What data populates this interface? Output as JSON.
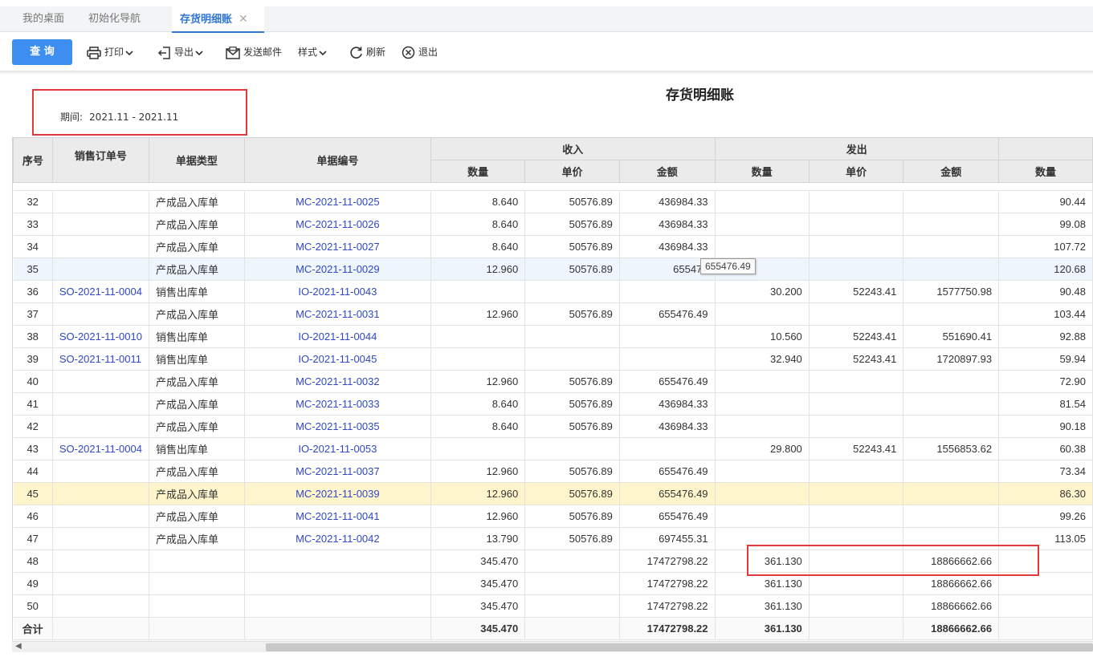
{
  "tabs": [
    {
      "label": "我的桌面"
    },
    {
      "label": "初始化导航"
    },
    {
      "label": "存货明细账"
    }
  ],
  "tab_close_glyph": "✕",
  "toolbar": {
    "query": "查 询",
    "print": "打印",
    "export": "导出",
    "email": "发送邮件",
    "style": "样式",
    "refresh": "刷新",
    "exit": "退出"
  },
  "report": {
    "title": "存货明细账",
    "period_label": "期间:",
    "period_value": "2021.11 - 2021.11"
  },
  "columns": {
    "seq": "序号",
    "order": "销售订单号",
    "type": "单据类型",
    "docno": "单据编号",
    "in_group": "收入",
    "out_group": "发出",
    "qty": "数量",
    "price": "单价",
    "amount": "金额"
  },
  "rows": [
    {
      "seq": "32",
      "order": "",
      "type": "产成品入库单",
      "docno": "MC-2021-11-0025",
      "in_qty": "8.640",
      "in_price": "50576.89",
      "in_amt": "436984.33",
      "out_qty": "",
      "out_price": "",
      "out_amt": "",
      "bal_qty": "90.44"
    },
    {
      "seq": "33",
      "order": "",
      "type": "产成品入库单",
      "docno": "MC-2021-11-0026",
      "in_qty": "8.640",
      "in_price": "50576.89",
      "in_amt": "436984.33",
      "out_qty": "",
      "out_price": "",
      "out_amt": "",
      "bal_qty": "99.08"
    },
    {
      "seq": "34",
      "order": "",
      "type": "产成品入库单",
      "docno": "MC-2021-11-0027",
      "in_qty": "8.640",
      "in_price": "50576.89",
      "in_amt": "436984.33",
      "out_qty": "",
      "out_price": "",
      "out_amt": "",
      "bal_qty": "107.72"
    },
    {
      "seq": "35",
      "order": "",
      "type": "产成品入库单",
      "docno": "MC-2021-11-0029",
      "in_qty": "12.960",
      "in_price": "50576.89",
      "in_amt": "655476",
      "out_qty": "",
      "out_price": "",
      "out_amt": "",
      "bal_qty": "120.68"
    },
    {
      "seq": "36",
      "order": "SO-2021-11-0004",
      "type": "销售出库单",
      "docno": "IO-2021-11-0043",
      "in_qty": "",
      "in_price": "",
      "in_amt": "",
      "out_qty": "30.200",
      "out_price": "52243.41",
      "out_amt": "1577750.98",
      "bal_qty": "90.48"
    },
    {
      "seq": "37",
      "order": "",
      "type": "产成品入库单",
      "docno": "MC-2021-11-0031",
      "in_qty": "12.960",
      "in_price": "50576.89",
      "in_amt": "655476.49",
      "out_qty": "",
      "out_price": "",
      "out_amt": "",
      "bal_qty": "103.44"
    },
    {
      "seq": "38",
      "order": "SO-2021-11-0010",
      "type": "销售出库单",
      "docno": "IO-2021-11-0044",
      "in_qty": "",
      "in_price": "",
      "in_amt": "",
      "out_qty": "10.560",
      "out_price": "52243.41",
      "out_amt": "551690.41",
      "bal_qty": "92.88"
    },
    {
      "seq": "39",
      "order": "SO-2021-11-0011",
      "type": "销售出库单",
      "docno": "IO-2021-11-0045",
      "in_qty": "",
      "in_price": "",
      "in_amt": "",
      "out_qty": "32.940",
      "out_price": "52243.41",
      "out_amt": "1720897.93",
      "bal_qty": "59.94"
    },
    {
      "seq": "40",
      "order": "",
      "type": "产成品入库单",
      "docno": "MC-2021-11-0032",
      "in_qty": "12.960",
      "in_price": "50576.89",
      "in_amt": "655476.49",
      "out_qty": "",
      "out_price": "",
      "out_amt": "",
      "bal_qty": "72.90"
    },
    {
      "seq": "41",
      "order": "",
      "type": "产成品入库单",
      "docno": "MC-2021-11-0033",
      "in_qty": "8.640",
      "in_price": "50576.89",
      "in_amt": "436984.33",
      "out_qty": "",
      "out_price": "",
      "out_amt": "",
      "bal_qty": "81.54"
    },
    {
      "seq": "42",
      "order": "",
      "type": "产成品入库单",
      "docno": "MC-2021-11-0035",
      "in_qty": "8.640",
      "in_price": "50576.89",
      "in_amt": "436984.33",
      "out_qty": "",
      "out_price": "",
      "out_amt": "",
      "bal_qty": "90.18"
    },
    {
      "seq": "43",
      "order": "SO-2021-11-0004",
      "type": "销售出库单",
      "docno": "IO-2021-11-0053",
      "in_qty": "",
      "in_price": "",
      "in_amt": "",
      "out_qty": "29.800",
      "out_price": "52243.41",
      "out_amt": "1556853.62",
      "bal_qty": "60.38"
    },
    {
      "seq": "44",
      "order": "",
      "type": "产成品入库单",
      "docno": "MC-2021-11-0037",
      "in_qty": "12.960",
      "in_price": "50576.89",
      "in_amt": "655476.49",
      "out_qty": "",
      "out_price": "",
      "out_amt": "",
      "bal_qty": "73.34"
    },
    {
      "seq": "45",
      "order": "",
      "type": "产成品入库单",
      "docno": "MC-2021-11-0039",
      "in_qty": "12.960",
      "in_price": "50576.89",
      "in_amt": "655476.49",
      "out_qty": "",
      "out_price": "",
      "out_amt": "",
      "bal_qty": "86.30"
    },
    {
      "seq": "46",
      "order": "",
      "type": "产成品入库单",
      "docno": "MC-2021-11-0041",
      "in_qty": "12.960",
      "in_price": "50576.89",
      "in_amt": "655476.49",
      "out_qty": "",
      "out_price": "",
      "out_amt": "",
      "bal_qty": "99.26"
    },
    {
      "seq": "47",
      "order": "",
      "type": "产成品入库单",
      "docno": "MC-2021-11-0042",
      "in_qty": "13.790",
      "in_price": "50576.89",
      "in_amt": "697455.31",
      "out_qty": "",
      "out_price": "",
      "out_amt": "",
      "bal_qty": "113.05"
    },
    {
      "seq": "48",
      "order": "",
      "type": "",
      "docno": "",
      "in_qty": "345.470",
      "in_price": "",
      "in_amt": "17472798.22",
      "out_qty": "361.130",
      "out_price": "",
      "out_amt": "18866662.66",
      "bal_qty": ""
    },
    {
      "seq": "49",
      "order": "",
      "type": "",
      "docno": "",
      "in_qty": "345.470",
      "in_price": "",
      "in_amt": "17472798.22",
      "out_qty": "361.130",
      "out_price": "",
      "out_amt": "18866662.66",
      "bal_qty": ""
    },
    {
      "seq": "50",
      "order": "",
      "type": "",
      "docno": "",
      "in_qty": "345.470",
      "in_price": "",
      "in_amt": "17472798.22",
      "out_qty": "361.130",
      "out_price": "",
      "out_amt": "18866662.66",
      "bal_qty": ""
    }
  ],
  "hover_row": "35",
  "selected_row": "45",
  "tooltip": "655476.49",
  "totals": {
    "label": "合计",
    "in_qty": "345.470",
    "in_amt": "17472798.22",
    "out_qty": "361.130",
    "out_amt": "18866662.66"
  },
  "colors": {
    "accent": "#3d8ef0",
    "link": "#2f48c8",
    "highlight_box": "#e2393b",
    "selected_row": "#fff5cc",
    "hover_row": "#eef5fd"
  }
}
